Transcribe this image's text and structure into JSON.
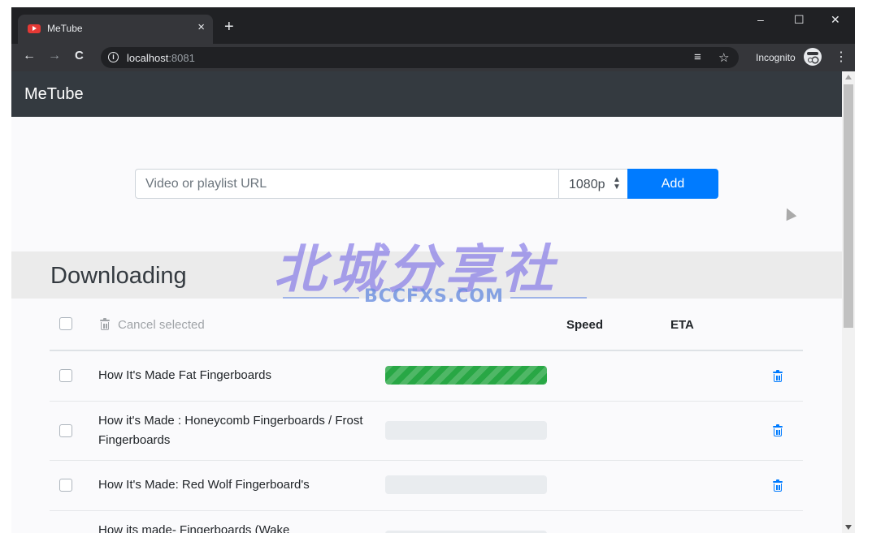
{
  "browser": {
    "tab_title": "MeTube",
    "tab_close": "×",
    "new_tab": "+",
    "minimize": "–",
    "maximize": "☐",
    "close": "✕",
    "back": "←",
    "forward": "→",
    "reload": "C",
    "url_host": "localhost",
    "url_port": ":8081",
    "incognito_label": "Incognito",
    "menu": "⋮"
  },
  "app": {
    "brand": "MeTube",
    "url_placeholder": "Video or playlist URL",
    "quality_value": "1080p",
    "add_label": "Add"
  },
  "downloading": {
    "title": "Downloading",
    "cancel_selected": "Cancel selected",
    "columns": {
      "speed": "Speed",
      "eta": "ETA"
    },
    "items": [
      {
        "title": "How It's Made Fat Fingerboards",
        "progress": 100
      },
      {
        "title": "How it's Made : Honeycomb Fingerboards / Frost Fingerboards",
        "progress": 0
      },
      {
        "title": "How It's Made: Red Wolf Fingerboard's",
        "progress": 0
      },
      {
        "title": "How its made- Fingerboards (Wake",
        "progress": 0
      }
    ]
  },
  "watermark": {
    "cn": "北城分享社",
    "en": "BCCFXS.COM"
  },
  "colors": {
    "primary": "#007bff",
    "success": "#28a745",
    "navbar": "#343a40"
  }
}
